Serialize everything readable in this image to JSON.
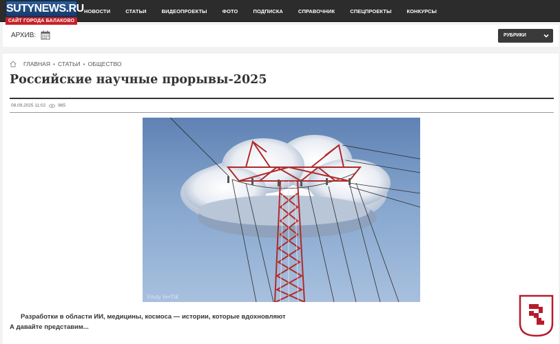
{
  "header": {
    "logo_name": "SUTYNEWS.RU",
    "logo_tagline": "САЙТ ГОРОДА БАЛАКОВО",
    "nav": [
      {
        "label": "НОВОСТИ"
      },
      {
        "label": "СТАТЬИ"
      },
      {
        "label": "ВИДЕОПРОЕКТЫ"
      },
      {
        "label": "ФОТО"
      },
      {
        "label": "ПОДПИСКА"
      },
      {
        "label": "СПРАВОЧНИК"
      },
      {
        "label": "СПЕЦПРОЕКТЫ"
      },
      {
        "label": "КОНКУРСЫ"
      }
    ]
  },
  "archive": {
    "label": "АРХИВ:",
    "icon": "calendar-icon",
    "rubrics_label": "РУБРИКИ"
  },
  "breadcrumbs": [
    "ГЛАВНАЯ",
    "СТАТЬИ",
    "ОБЩЕСТВО"
  ],
  "article": {
    "title": "Российские научные прорывы-2025",
    "date": "08.09.2025 11:02",
    "views": "965",
    "photo_signature": "Vitaly VerTiK",
    "lead": "Разработки в области ИИ, медицины, космоса — истории, которые вдохновляют",
    "lead_continued": "А давайте представим..."
  },
  "colors": {
    "nav_bg": "#2c2c2c",
    "logo_blue": "#1f4a80",
    "logo_red": "#c62128",
    "badge_red": "#b71c2a"
  }
}
